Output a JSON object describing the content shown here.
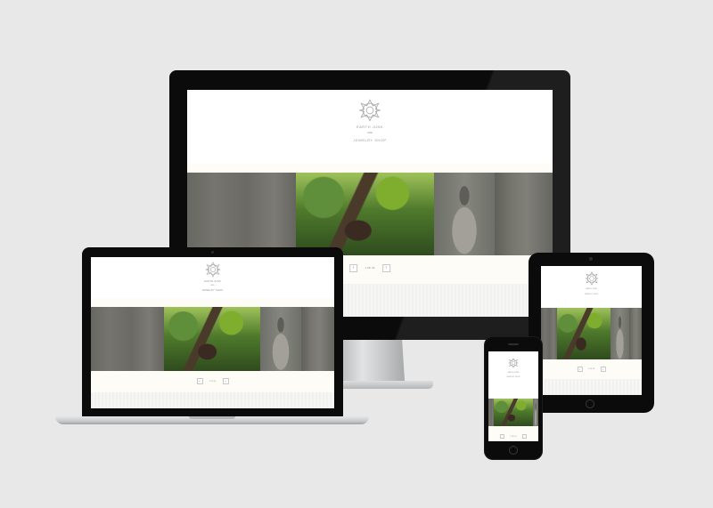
{
  "site": {
    "brand": "EARTH JUNK",
    "tagline": "ARE",
    "subtitle": "JEWELRY SHOP",
    "gallery_counter": "1 OF 24",
    "prev_icon": "chevron-left-icon",
    "next_icon": "chevron-right-icon",
    "social_icons": [
      "twitter-icon",
      "pinterest-icon",
      "facebook-icon",
      "mail-icon"
    ]
  },
  "colors": {
    "background": "#e8e8e8",
    "device_black": "#0b0b0b",
    "aluminum": "#c9cbcd",
    "strip": "#fdfcf6",
    "foliage": "#7fae2f"
  }
}
